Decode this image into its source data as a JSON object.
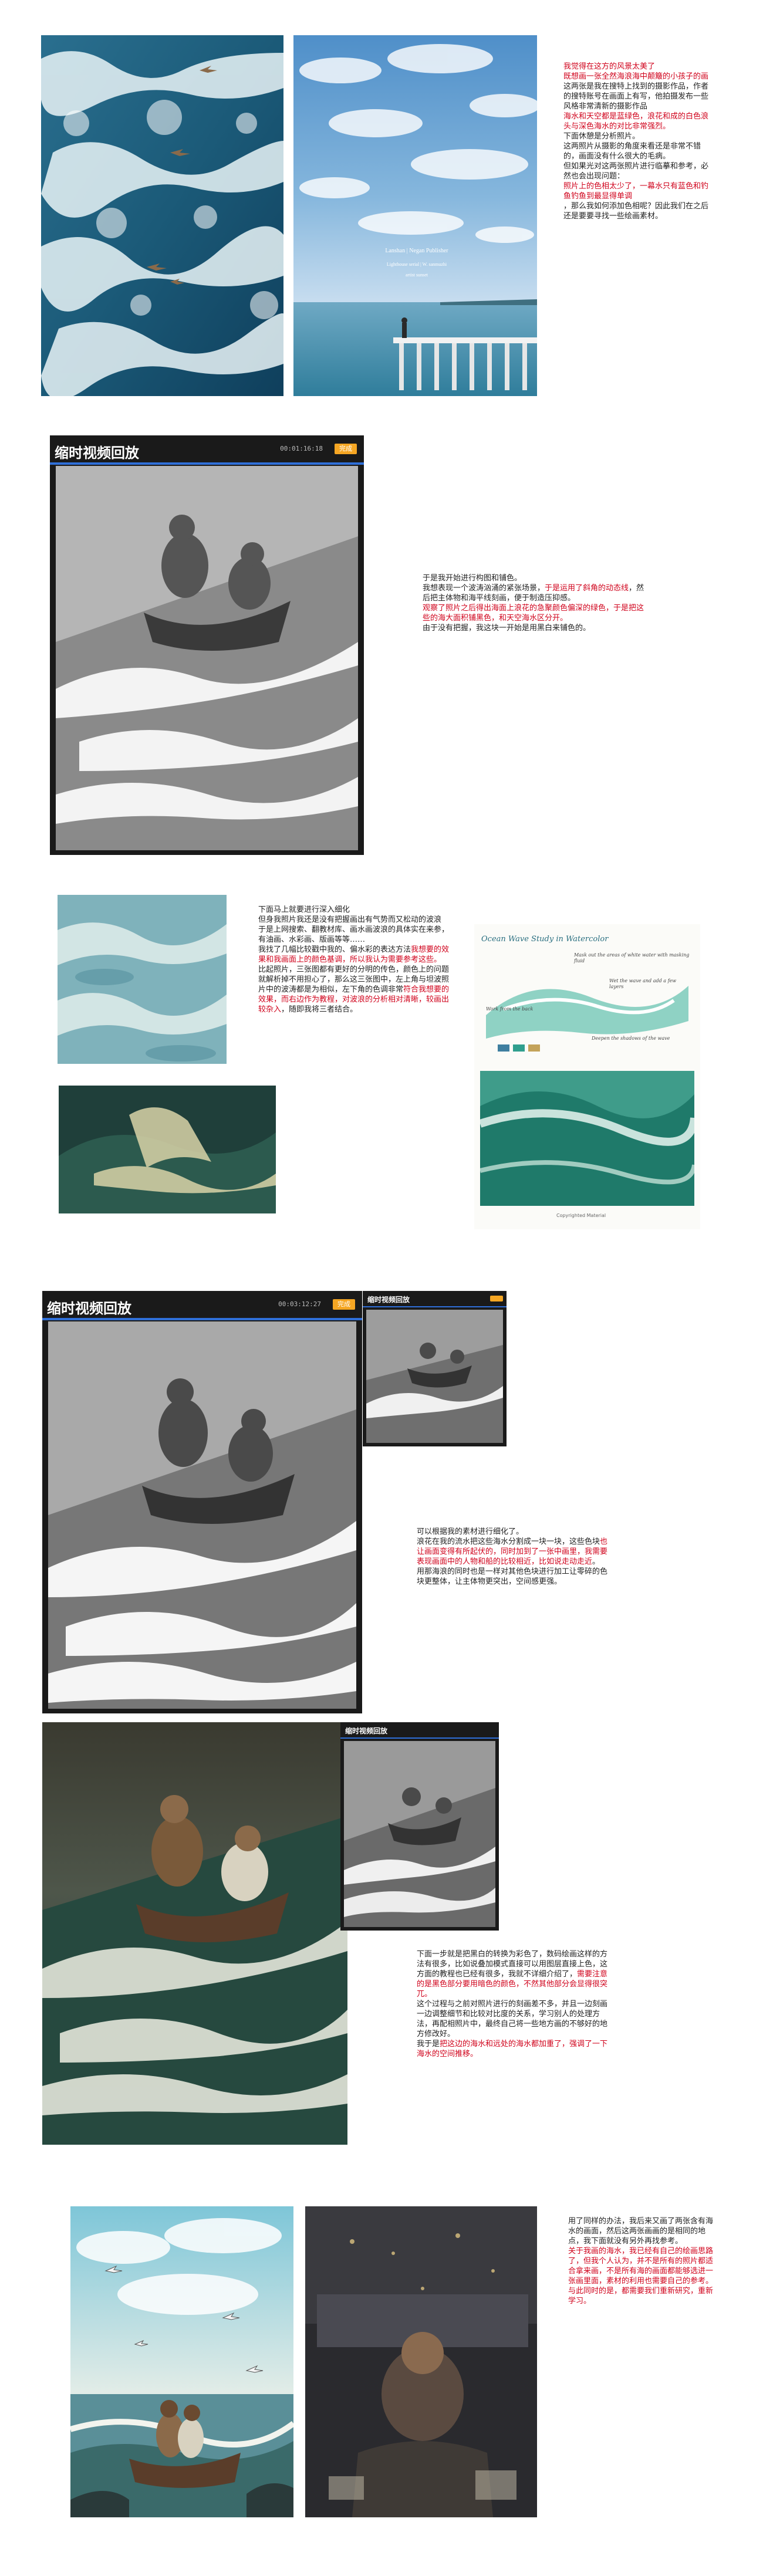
{
  "section1": {
    "poster": {
      "line1": "Lanshan | Negan Publisher",
      "line2": "Lighthouse serial | W. sanmuzhi",
      "line3": "artist sunset"
    },
    "text": [
      {
        "t": "我觉得在这方的风景太美了",
        "red": true
      },
      {
        "t": "既想画一张全然海浪海中颠簸的小孩子的画",
        "red": true
      },
      {
        "t": "这两张是我在搜特上找到的摄影作品，作者的搜特账号在画面上有写，他拍摄发布一些风格非常清新的摄影作品",
        "red": false
      },
      {
        "t": "海水和天空都是蓝绿色，浪花和成的白色浪头与深色海水的对比非常强烈。",
        "red": true
      },
      {
        "t": "下面休憩是分析照片。\n这两照片从摄影的角度来看还是非常不错的，画面没有什么很大的毛病。\n但如果光对这两张照片进行临摹和参考，必然也会出现问题：",
        "red": false
      },
      {
        "t": "照片上的色相太少了，一幕水只有蓝色和钓鱼钓鱼到最显得单调",
        "red": true
      },
      {
        "t": "，那么我如何添加色相呢？因此我们在之后还是要要寻找一些绘画素材。",
        "red": false
      }
    ]
  },
  "section2": {
    "player": {
      "title": "缩时视频回放",
      "time": "00:01:16:18",
      "button": "完成"
    },
    "text": [
      {
        "t": "于是我开始进行构图和铺色。\n我想表现一个波涛汹涌的紧张场景，",
        "red": false
      },
      {
        "t": "于是运用了斜角的动态线",
        "red": true
      },
      {
        "t": "，然后把主体物和海平线刻画，便于制造压抑感。",
        "red": false
      },
      {
        "t": "观察了照片之后得出海面上浪花的急聚颜色偏深的绿色，于是把这些的海大面积铺黑色，和天空海水区分开。",
        "red": true
      },
      {
        "t": "由于没有把握，我这块一开始是用黑白来铺色的。",
        "red": false
      }
    ]
  },
  "section3": {
    "text": [
      {
        "t": "下面马上就要进行深入细化\n但身我照片我还是没有把握画出有气势而又松动的波浪\n于是上网搜索、翻教材库、画水画波浪的具体实在来参，有油画、水彩画、版画等等……\n我找了几幅比较戳中我的、偏水彩的表达方法",
        "red": false
      },
      {
        "t": "我想要的效果和我画面上的颜色基调，所以我认为需要参考这些。",
        "red": true
      },
      {
        "t": "比起照片，三张图都有更好的分明的传色，颜色上的问题就解析掉不用担心了，那么这三张图中，左上角与坦波照片中的波涛都是为相似，左下角的色调非常",
        "red": false
      },
      {
        "t": "符合我想要的效果，而右边作为教程，对波浪的分析相对清晰，较画出较杂入",
        "red": true
      },
      {
        "t": "，随即我将三者结合。",
        "red": false
      }
    ],
    "tutorial": {
      "heading": "Ocean Wave Study in Watercolor",
      "notes": [
        "Mask out the areas of white water with masking fluid",
        "Wet the wave and add a few layers",
        "Work from the back",
        "Deepen the shadows of the wave"
      ],
      "caption": "Copyrighted Material"
    }
  },
  "section4": {
    "player": {
      "title": "缩时视频回放",
      "time": "00:03:12:27",
      "button": "完成"
    },
    "small_player": {
      "title": "缩时视频回放"
    },
    "text": [
      {
        "t": "可以根据我的素材进行细化了。\n浪花在我的流水把这些海水分割成一块一块，这些色块",
        "red": false
      },
      {
        "t": "也让画面变得有所起伏的，同时加到了一张中画里，我需要表现画面中的人物和船的比较相近，比如说走动走近",
        "red": true
      },
      {
        "t": "。\n用那海浪的同时也是一样对其他色块进行加工让零碎的色块更整体，让主体物更突出，空间感更强。",
        "red": false
      }
    ]
  },
  "section5": {
    "small_player": {
      "title": "缩时视频回放"
    },
    "text": [
      {
        "t": "下面一步就是把黑白的转换为彩色了，数码绘画这样的方法有很多，比如说叠加模式直接可以用图层直接上色，这方面的教程也已经有很多，我就不详细介绍了，",
        "red": false
      },
      {
        "t": "需要注意的是黑色部分要用暗色的颜色，不然其他部分会显得很突兀。",
        "red": true
      },
      {
        "t": "这个过程与之前对照片进行的刻画差不多，并且一边刻画一边调整细节和比较对比度的关系，学习别人的处理方法，再配相照片中，最终自己将一些地方画的不够好的地方修改好。\n我于是",
        "red": false
      },
      {
        "t": "把这边的海水和远处的海水都加重了，强调了一下海水的空间推移。",
        "red": true
      }
    ]
  },
  "section6": {
    "text": [
      {
        "t": "用了同样的办法，我后来又画了两张含有海水的画面，然后这两张画画的是相同的地点，我下面就没有另外再找参考。",
        "red": false
      },
      {
        "t": "关于我画的海水，我已经有自己的绘画思路了，但我个人认为，并不是所有的照片都适合拿来画，不是所有海的画面都能够选进一张画里面，素材的利用也需要自己的参考。与此同时的是，都需要我们重新研究，重新学习。",
        "red": true
      }
    ]
  }
}
